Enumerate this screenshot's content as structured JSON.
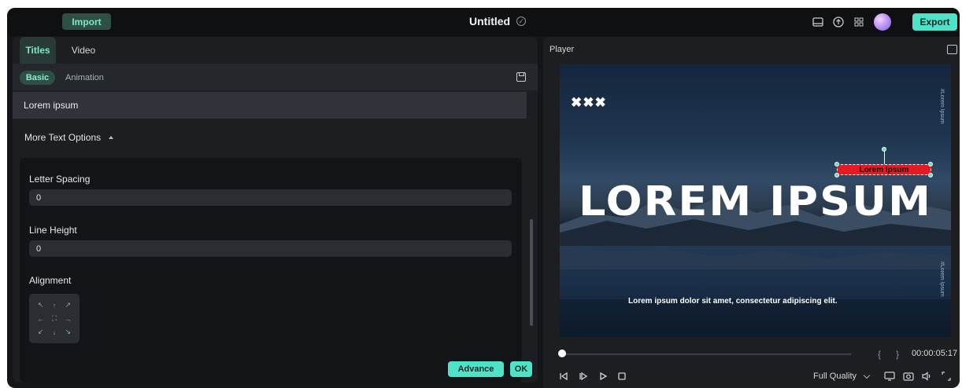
{
  "topbar": {
    "import_label": "Import",
    "title": "Untitled",
    "export_label": "Export",
    "accent": "#4ee3c9"
  },
  "left_panel": {
    "tabs": [
      {
        "label": "Titles",
        "active": true
      },
      {
        "label": "Video",
        "active": false
      }
    ],
    "subtabs": [
      {
        "label": "Basic",
        "active": true
      },
      {
        "label": "Animation",
        "active": false
      }
    ],
    "text_value": "Lorem ipsum",
    "more_options_label": "More Text Options",
    "letter_spacing": {
      "label": "Letter Spacing",
      "value": "0"
    },
    "line_height": {
      "label": "Line Height",
      "value": "0"
    },
    "alignment": {
      "label": "Alignment"
    },
    "advance_label": "Advance",
    "ok_label": "OK"
  },
  "player": {
    "label": "Player",
    "overlay_marks": "✖✖✖",
    "headline": "LOREM IPSUM",
    "selected_text": "Lorem Ipsum",
    "vertical_text": "#Lorem Ipsum",
    "subtitle": "Lorem ipsum dolor sit amet, consectetur adipiscing elit.",
    "timecode": "00:00:05:17",
    "quality": "Full Quality",
    "brace_left": "{",
    "brace_right": "}",
    "progress_fraction": 0.0
  }
}
